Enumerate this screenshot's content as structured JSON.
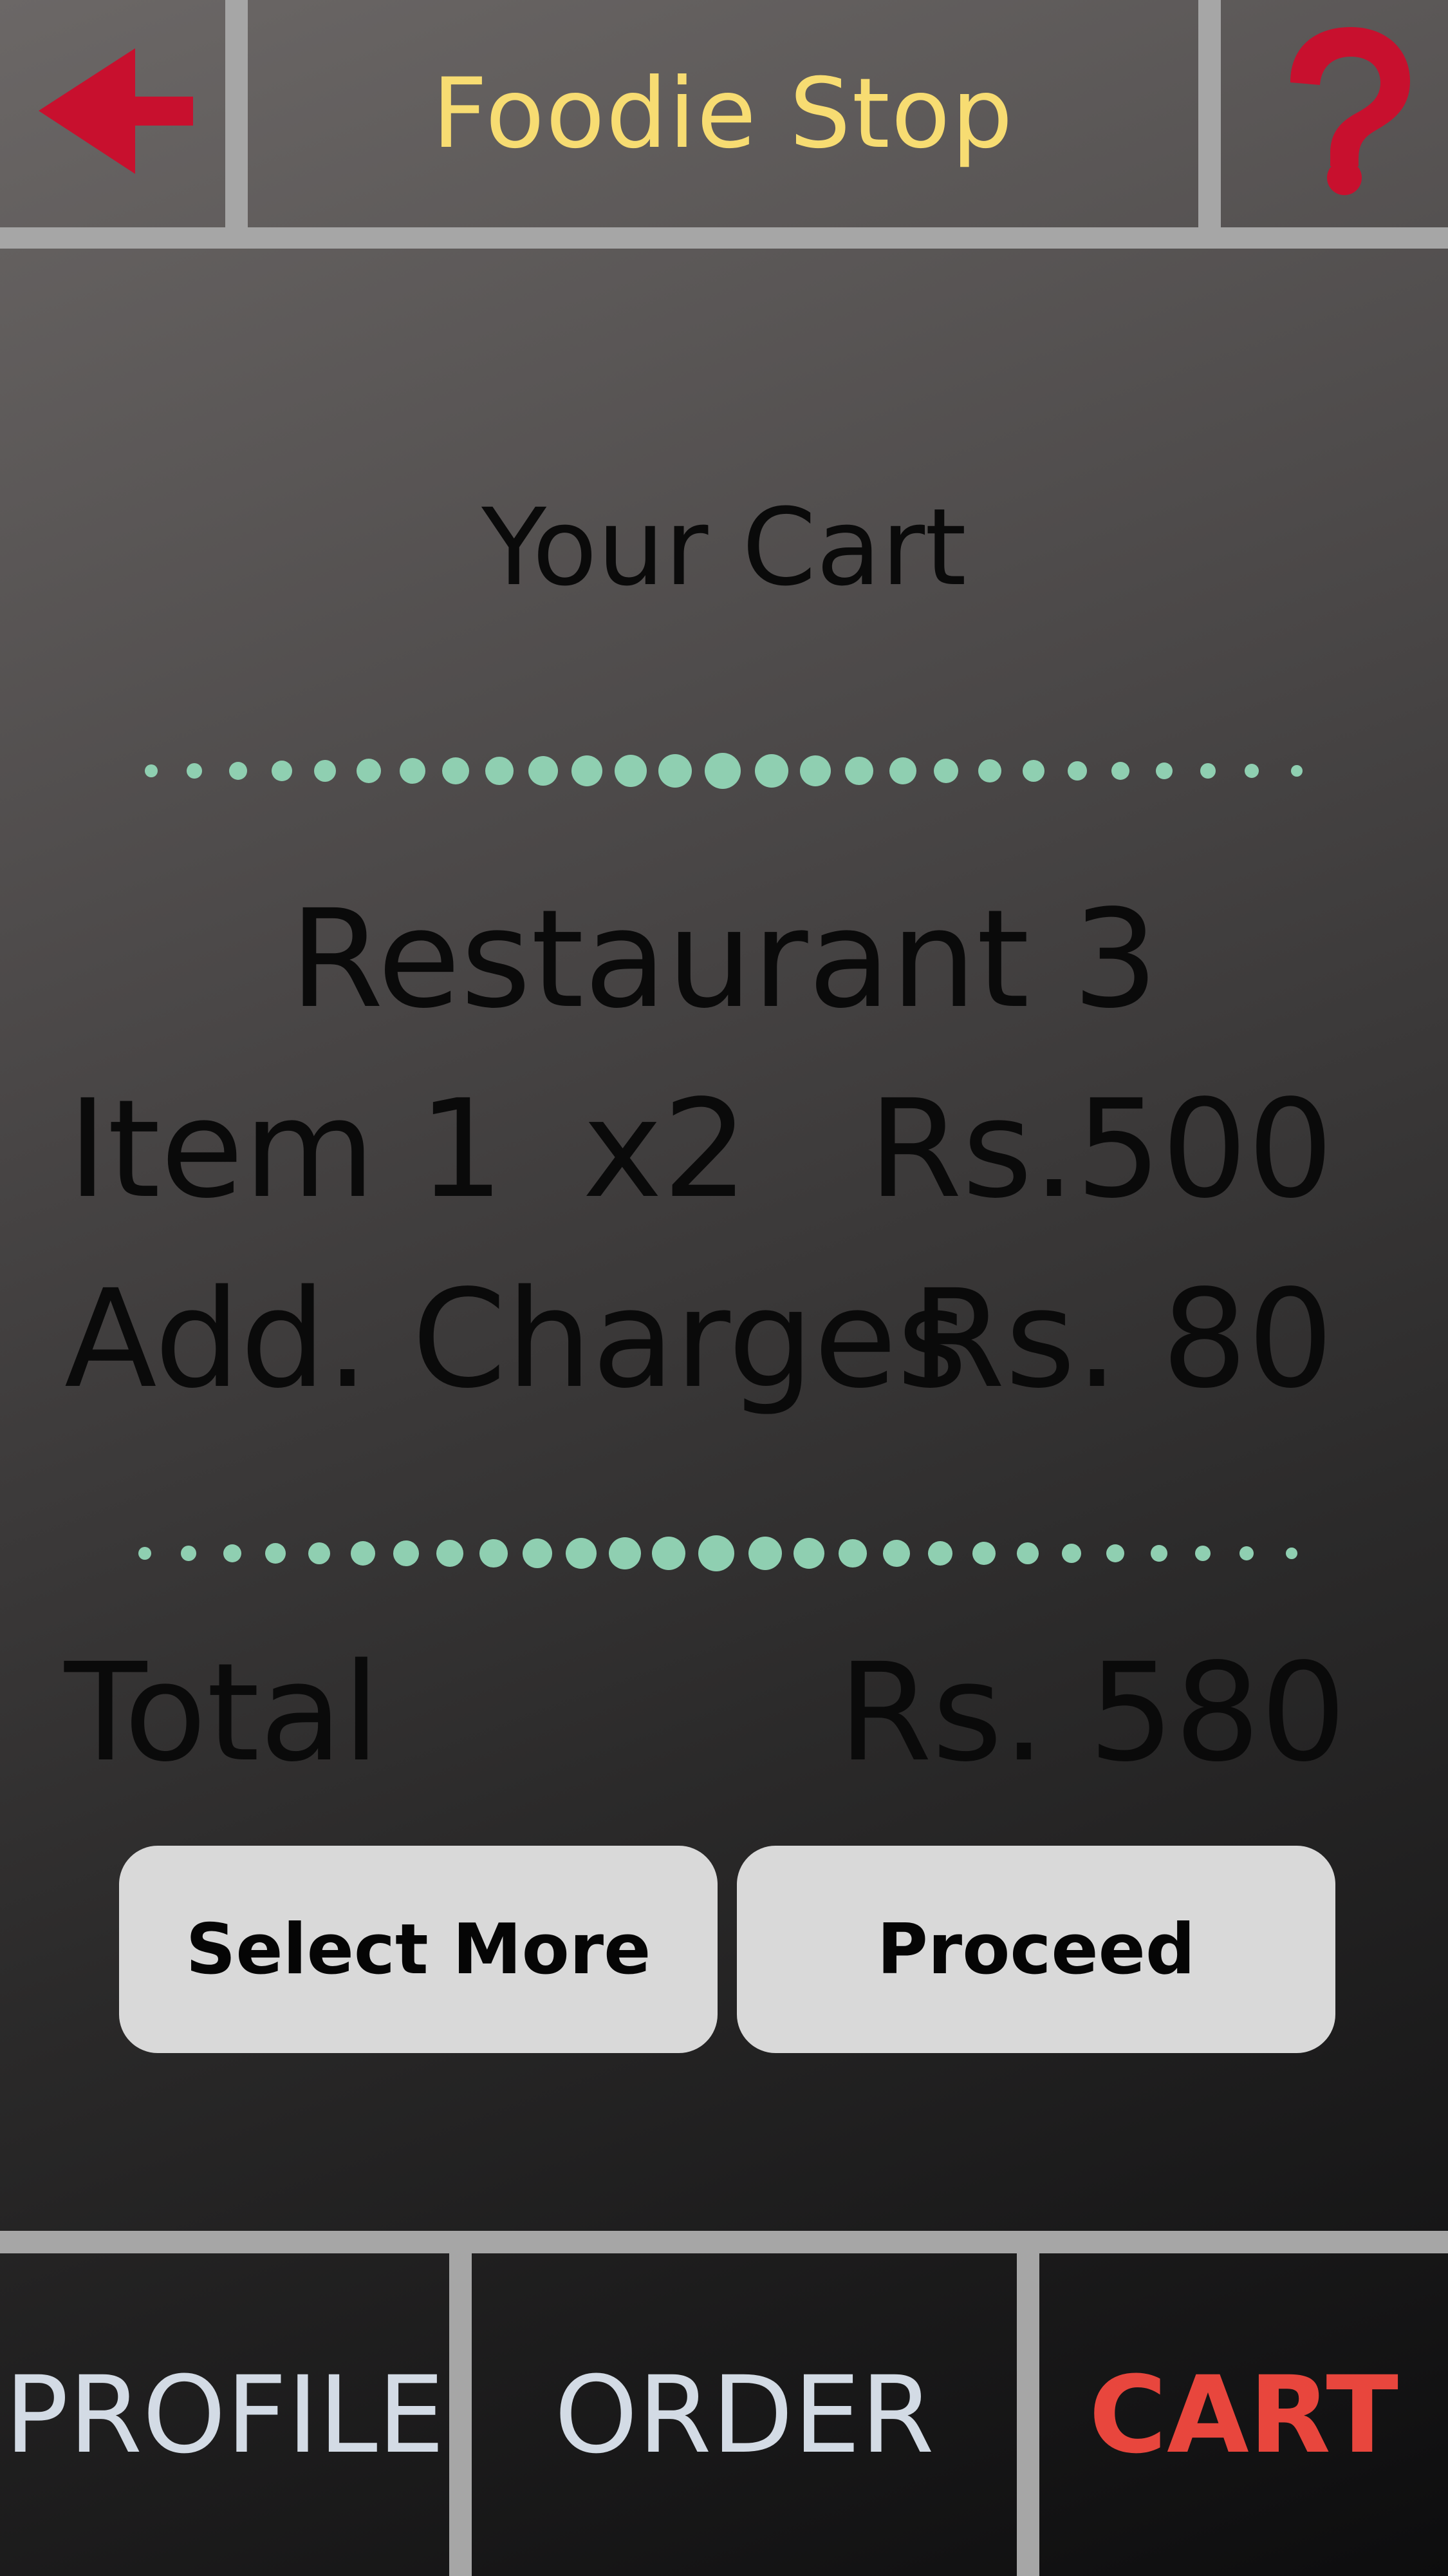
{
  "header": {
    "title": "Foodie Stop",
    "back_icon": "back-arrow-icon",
    "help_icon": "question-mark-icon"
  },
  "cart": {
    "heading": "Your Cart",
    "restaurant": "Restaurant 3",
    "item": {
      "name": "Item 1",
      "quantity": "x2",
      "price": "Rs.500"
    },
    "charges": {
      "label": "Add. Charges",
      "value": "Rs. 80"
    },
    "total": {
      "label": "Total",
      "value": "Rs. 580"
    }
  },
  "buttons": {
    "select_more": "Select More",
    "proceed": "Proceed"
  },
  "nav": {
    "profile": "PROFILE",
    "order": "ORDER",
    "cart": "CART"
  },
  "colors": {
    "title": "#f7dc72",
    "accent": "#c8102e",
    "dots": "#8fcfb1",
    "active_nav": "#e8463d",
    "nav_text": "#d3dbe5",
    "separator": "#a6a6a6",
    "button_bg": "#d9d9d9"
  }
}
